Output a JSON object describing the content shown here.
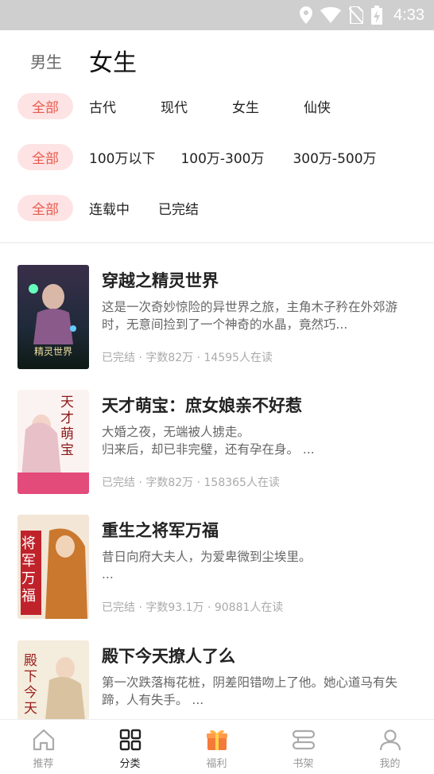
{
  "status_bar": {
    "time": "4:33"
  },
  "gender_tabs": {
    "male": "男生",
    "female": "女生"
  },
  "filters": {
    "category": [
      "全部",
      "古代",
      "现代",
      "女生",
      "仙侠"
    ],
    "word_count": [
      "全部",
      "100万以下",
      "100万-300万",
      "300万-500万"
    ],
    "status": [
      "全部",
      "连载中",
      "已完结"
    ]
  },
  "books": [
    {
      "title": "穿越之精灵世界",
      "desc": "这是一次奇妙惊险的异世界之旅，主角木子矜在外郊游时，无意间捡到了一个神奇的水晶，竟然巧...",
      "meta": "已完结 · 字数82万 · 14595人在读",
      "cover_text": "精灵世界"
    },
    {
      "title": "天才萌宝：庶女娘亲不好惹",
      "desc": "大婚之夜，无端被人掳走。\n归来后，却已非完璧，还有孕在身。 ...",
      "meta": "已完结 · 字数82万 · 158365人在读",
      "cover_text": "天才萌宝"
    },
    {
      "title": "重生之将军万福",
      "desc": "昔日向府大夫人，为爱卑微到尘埃里。\n...",
      "meta": "已完结 · 字数93.1万 · 90881人在读",
      "cover_text": "将军万福"
    },
    {
      "title": "殿下今天撩人了么",
      "desc": "第一次跌落梅花桩，阴差阳错吻上了他。她心道马有失蹄，人有失手。 ...",
      "meta": "",
      "cover_text": "殿下今天"
    }
  ],
  "tabbar": [
    {
      "label": "推荐",
      "icon": "home-icon"
    },
    {
      "label": "分类",
      "icon": "grid-icon"
    },
    {
      "label": "福利",
      "icon": "gift-icon"
    },
    {
      "label": "书架",
      "icon": "bookshelf-icon"
    },
    {
      "label": "我的",
      "icon": "user-icon"
    }
  ],
  "colors": {
    "accent": "#e85a4f",
    "chip_bg": "#fde3e3",
    "status_bar": "#cfcfcf"
  }
}
